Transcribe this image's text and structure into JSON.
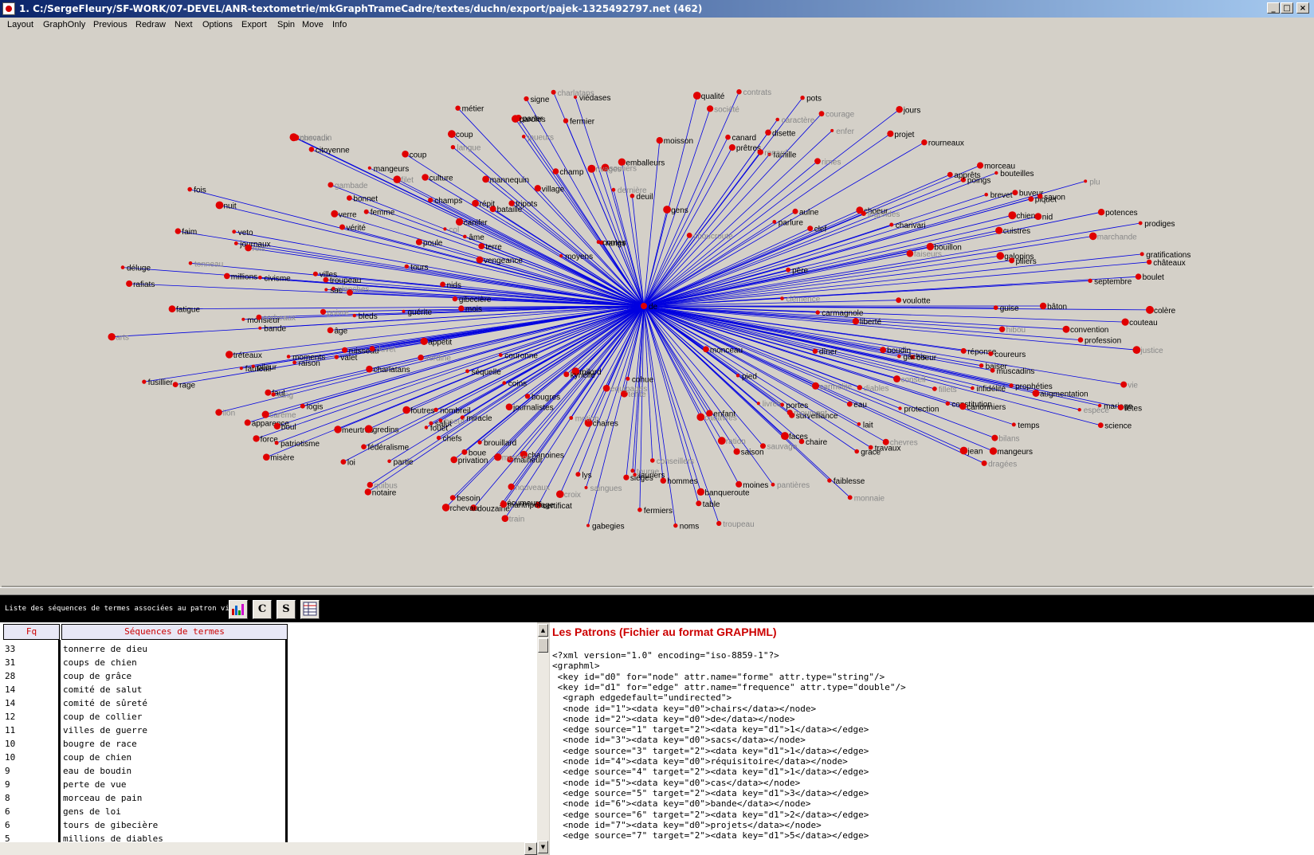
{
  "window": {
    "title": "1. C:/SergeFleury/SF-WORK/07-DEVEL/ANR-textometrie/mkGraphTrameCadre/textes/duchn/export/pajek-1325492797.net (462)",
    "controls": {
      "minimize": "_",
      "maximize": "□",
      "close": "×"
    }
  },
  "menu": [
    "Layout",
    "GraphOnly",
    "Previous",
    "Redraw",
    "Next",
    "Options",
    "Export",
    "Spin",
    "Move",
    "Info"
  ],
  "graph": {
    "center_label": "de",
    "colors": {
      "edge": "#0000e0",
      "node": "#e00000",
      "label_primary": "#000000",
      "label_secondary": "#888888",
      "background": "#d4d0c8"
    },
    "labels_primary": [
      "tours",
      "pileur",
      "poings",
      "certificat",
      "prophéties",
      "tripots",
      "bleds",
      "prodiges",
      "fusillier",
      "faul",
      "chaires",
      "ruisseau",
      "journalistes",
      "fouet",
      "bouillon",
      "âge",
      "apparence",
      "eau",
      "dîner",
      "coup",
      "boue",
      "rage",
      "valet",
      "deuil",
      "qualité",
      "potences",
      "mangeurs",
      "brouillard",
      "boul",
      "gabegies",
      "fédéralisme",
      "science",
      "apprêts",
      "mangeurs",
      "cohue",
      "parler",
      "choeur",
      "pied",
      "convention",
      "aulne",
      "réponse",
      "baiser",
      "écumeurs",
      "monceau",
      "infidélité",
      "bande",
      "moisson",
      "notaire",
      "champs",
      "mariage",
      "coeur",
      "profession",
      "meurtres",
      "civisme",
      "buveur",
      "piquet",
      "châteaux",
      "fatigue",
      "chiens",
      "citoyenne",
      "fêtes",
      "culture",
      "canard",
      "bouteilles",
      "gredins",
      "bataille",
      "surveillance",
      "milord",
      "gibecière",
      "faiblesse",
      "emballeurs",
      "verre",
      "chaire",
      "brevet",
      "grâce",
      "logis",
      "liberté",
      "tréteaux",
      "constitution",
      "couronne",
      "viédases",
      "villes",
      "table",
      "banqueroute",
      "galopins",
      "famille",
      "enfant",
      "fois",
      "salut",
      "nid",
      "champ",
      "jean",
      "femme",
      "journaux",
      "force",
      "millions",
      "séquelle",
      "misère",
      "cuistres",
      "appétit",
      "miracle",
      "coureurs",
      "boulet",
      "nids",
      "travaux",
      "hommes",
      "moines",
      "guérite",
      "monsieur",
      "âme",
      "malheur",
      "gratifications",
      "colère",
      "rourneaux",
      "père",
      "terre",
      "foutres",
      "poule",
      "rangs",
      "protection",
      "sièges",
      "déluge",
      "coins",
      "lait",
      "bougres",
      "besoin",
      "rafiats",
      "loi",
      "fermiers",
      "bonnet",
      "clef",
      "charlatans",
      "village",
      "canonniers",
      "muscadins",
      "bâton",
      "kyrielle",
      "fauteuil",
      "prêtres",
      "gens",
      "pots",
      "chanoines",
      "métier",
      "patriotisme",
      "disette",
      "partie",
      "moments",
      "sac",
      "septembre",
      "noms",
      "fermier",
      "parlure",
      "couteau",
      "moyens",
      "faces",
      "carmagnole",
      "veto",
      "lauriers",
      "mois",
      "paroles",
      "douzaine",
      "contes",
      "privation",
      "nuit",
      "charivari",
      "mannequin",
      "chefs",
      "rchevau",
      "guise",
      "jours",
      "saison",
      "faim",
      "mantripotage",
      "projet",
      "vengeance",
      "voulotte",
      "raison",
      "nombreil",
      "portes",
      "lys",
      "temps",
      "gâchis",
      "vérité",
      "augmentation",
      "piliers",
      "canifer",
      "troupeau",
      "boudin",
      "répit",
      "signe",
      "coup",
      "savon",
      "morceau"
    ],
    "labels_secondary": [
      "clémence",
      "muscadin",
      "tente",
      "croix",
      "conseil",
      "carmelite",
      "courage",
      "tonneau",
      "dernière",
      "enfer",
      "pantières",
      "mertons",
      "rois",
      "boeuf",
      "diables",
      "saingues",
      "troupeau",
      "carême",
      "cadavres",
      "espèce",
      "verdine",
      "filet",
      "moument",
      "lion",
      "caractère",
      "souliers",
      "chevaux",
      "faiseurs",
      "hibou",
      "quibus",
      "motion",
      "nouveaux",
      "société",
      "dragées",
      "renard",
      "monnaie",
      "joueurs",
      "contrats",
      "rimes",
      "tourne",
      "corbeaux",
      "marchande",
      "justice",
      "livres",
      "choucroute",
      "train",
      "fillets",
      "gambade",
      "équipages",
      "poivre",
      "langue",
      "conseillers",
      "col",
      "ration",
      "duvet",
      "rivages",
      "arts",
      "bilans",
      "vie",
      "charlatans",
      "planches",
      "légendes",
      "sauvage",
      "plu",
      "rang",
      "chevres"
    ],
    "edge_count": 462
  },
  "toolbar": {
    "caption": "Liste des séquences de termes associées au patron visé",
    "buttons": [
      "chart-icon",
      "C",
      "S",
      "grid-icon"
    ]
  },
  "table": {
    "headers": {
      "fq": "Fq",
      "seq": "Séquences de termes"
    },
    "rows": [
      {
        "fq": "33",
        "seq": "tonnerre de dieu"
      },
      {
        "fq": "31",
        "seq": "coups de chien"
      },
      {
        "fq": "28",
        "seq": "coup de grâce"
      },
      {
        "fq": "14",
        "seq": "comité de salut"
      },
      {
        "fq": "14",
        "seq": "comité de sûreté"
      },
      {
        "fq": "12",
        "seq": "coup de collier"
      },
      {
        "fq": "11",
        "seq": "villes de guerre"
      },
      {
        "fq": "10",
        "seq": "bougre de race"
      },
      {
        "fq": "10",
        "seq": "coup de chien"
      },
      {
        "fq": "9",
        "seq": "eau de boudin"
      },
      {
        "fq": "9",
        "seq": "perte de vue"
      },
      {
        "fq": "8",
        "seq": "morceau de pain"
      },
      {
        "fq": "6",
        "seq": "gens de loi"
      },
      {
        "fq": "6",
        "seq": "tours de gibecière"
      },
      {
        "fq": "5",
        "seq": "millions de diables"
      }
    ]
  },
  "xml": {
    "title": "Les Patrons (Fichier au format GRAPHML)",
    "lines": [
      "<?xml version=\"1.0\" encoding=\"iso-8859-1\"?>",
      "<graphml>",
      " <key id=\"d0\" for=\"node\" attr.name=\"forme\" attr.type=\"string\"/>",
      " <key id=\"d1\" for=\"edge\" attr.name=\"frequence\" attr.type=\"double\"/>",
      "  <graph edgedefault=\"undirected\">",
      "  <node id=\"1\"><data key=\"d0\">chairs</data></node>",
      "  <node id=\"2\"><data key=\"d0\">de</data></node>",
      "  <edge source=\"1\" target=\"2\"><data key=\"d1\">1</data></edge>",
      "  <node id=\"3\"><data key=\"d0\">sacs</data></node>",
      "  <edge source=\"3\" target=\"2\"><data key=\"d1\">1</data></edge>",
      "  <node id=\"4\"><data key=\"d0\">réquisitoire</data></node>",
      "  <edge source=\"4\" target=\"2\"><data key=\"d1\">1</data></edge>",
      "  <node id=\"5\"><data key=\"d0\">cas</data></node>",
      "  <edge source=\"5\" target=\"2\"><data key=\"d1\">3</data></edge>",
      "  <node id=\"6\"><data key=\"d0\">bande</data></node>",
      "  <edge source=\"6\" target=\"2\"><data key=\"d1\">2</data></edge>",
      "  <node id=\"7\"><data key=\"d0\">projets</data></node>",
      "  <edge source=\"7\" target=\"2\"><data key=\"d1\">5</data></edge>"
    ]
  }
}
